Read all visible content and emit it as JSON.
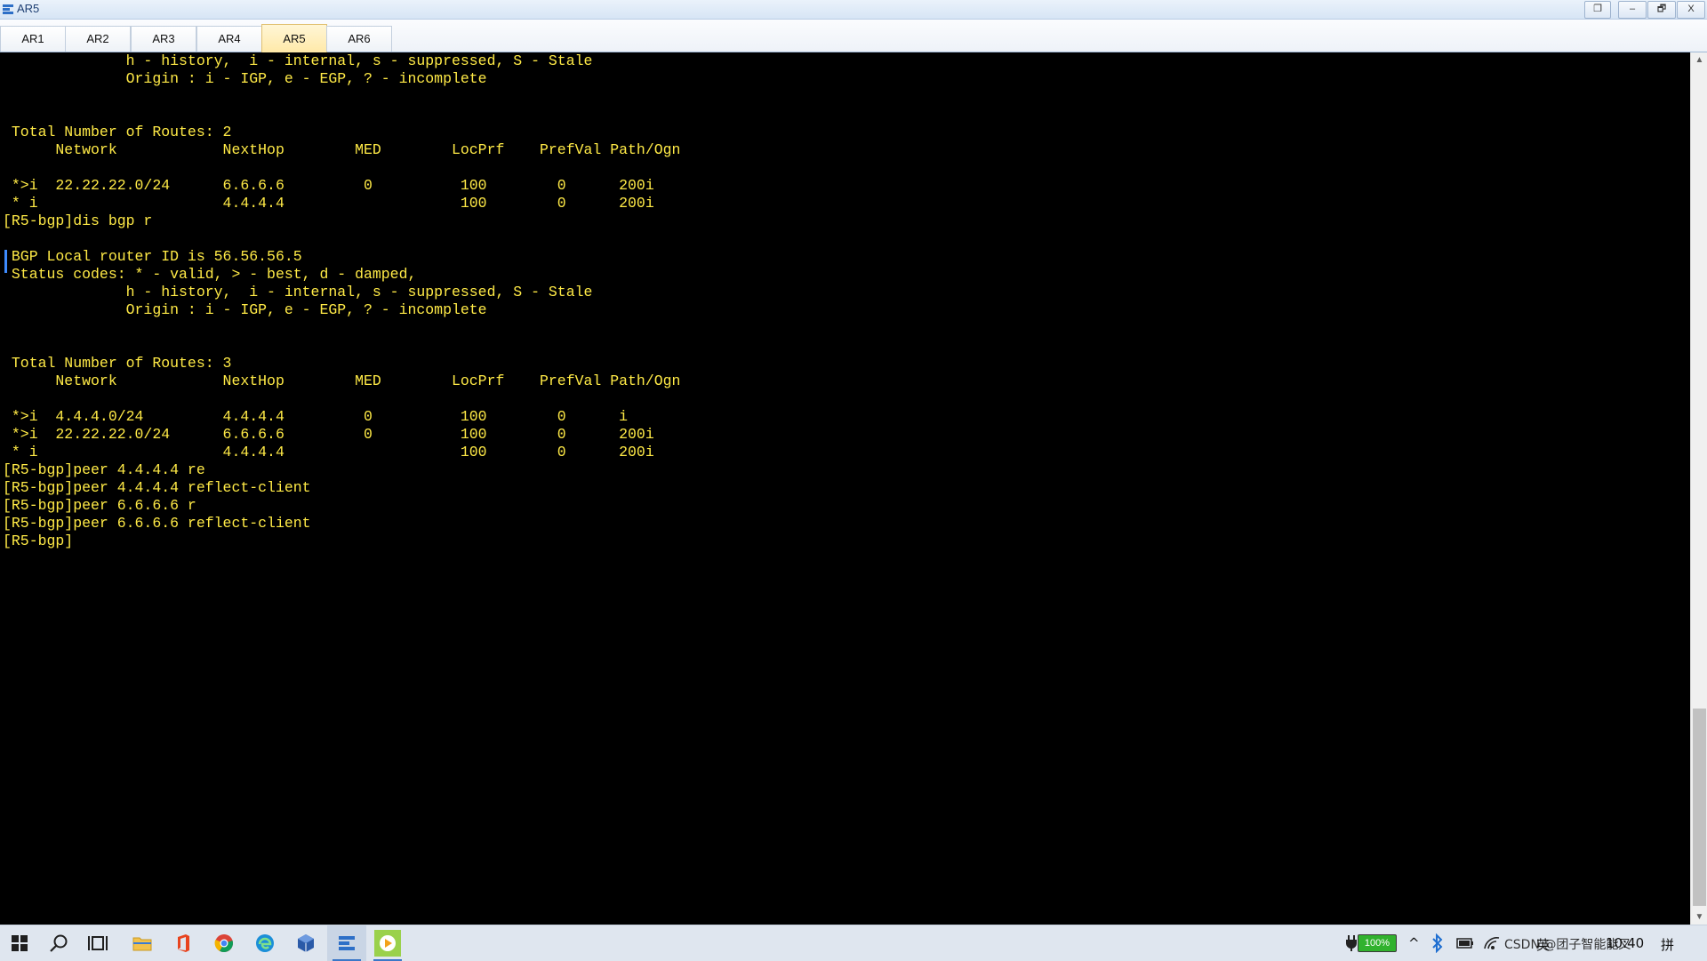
{
  "window": {
    "title": "AR5",
    "controls": {
      "restore_down": "❐",
      "minimize": "–",
      "maximize": "🗗",
      "close": "X"
    }
  },
  "tabs": [
    {
      "label": "AR1",
      "active": false
    },
    {
      "label": "AR2",
      "active": false
    },
    {
      "label": "AR3",
      "active": false
    },
    {
      "label": "AR4",
      "active": false
    },
    {
      "label": "AR5",
      "active": true
    },
    {
      "label": "AR6",
      "active": false
    }
  ],
  "terminal": {
    "text_color": "#ffea46",
    "lines": [
      "              h - history,  i - internal, s - suppressed, S - Stale",
      "              Origin : i - IGP, e - EGP, ? - incomplete",
      "",
      "",
      " Total Number of Routes: 2",
      "      Network            NextHop        MED        LocPrf    PrefVal Path/Ogn",
      "",
      " *>i  22.22.22.0/24      6.6.6.6         0          100        0      200i",
      " * i                     4.4.4.4                    100        0      200i",
      "[R5-bgp]dis bgp r",
      "",
      " BGP Local router ID is 56.56.56.5",
      " Status codes: * - valid, > - best, d - damped,",
      "              h - history,  i - internal, s - suppressed, S - Stale",
      "              Origin : i - IGP, e - EGP, ? - incomplete",
      "",
      "",
      " Total Number of Routes: 3",
      "      Network            NextHop        MED        LocPrf    PrefVal Path/Ogn",
      "",
      " *>i  4.4.4.0/24         4.4.4.4         0          100        0      i",
      " *>i  22.22.22.0/24      6.6.6.6         0          100        0      200i",
      " * i                     4.4.4.4                    100        0      200i",
      "[R5-bgp]peer 4.4.4.4 re",
      "[R5-bgp]peer 4.4.4.4 reflect-client",
      "[R5-bgp]peer 6.6.6.6 r",
      "[R5-bgp]peer 6.6.6.6 reflect-client",
      "[R5-bgp]"
    ]
  },
  "scrollbar": {
    "up_arrow": "▲",
    "down_arrow": "▼"
  },
  "taskbar": {
    "apps": [
      {
        "name": "start-button",
        "icon": "windows-logo"
      },
      {
        "name": "search-button",
        "icon": "magnifier"
      },
      {
        "name": "task-view-button",
        "icon": "task-view"
      },
      {
        "name": "file-explorer-taskbar",
        "icon": "folder"
      },
      {
        "name": "office-taskbar",
        "icon": "office"
      },
      {
        "name": "chrome-taskbar",
        "icon": "chrome"
      },
      {
        "name": "edge-taskbar",
        "icon": "edge"
      },
      {
        "name": "virtualbox-taskbar",
        "icon": "cube"
      },
      {
        "name": "ensp-taskbar",
        "icon": "ensp"
      },
      {
        "name": "media-taskbar",
        "icon": "play"
      }
    ],
    "battery": "100%",
    "tray_chevron": "^",
    "ime_mode": "英",
    "ime_name": "拼",
    "watermark_text": "CSDN @团子智能能叉",
    "clock": "10:40"
  }
}
